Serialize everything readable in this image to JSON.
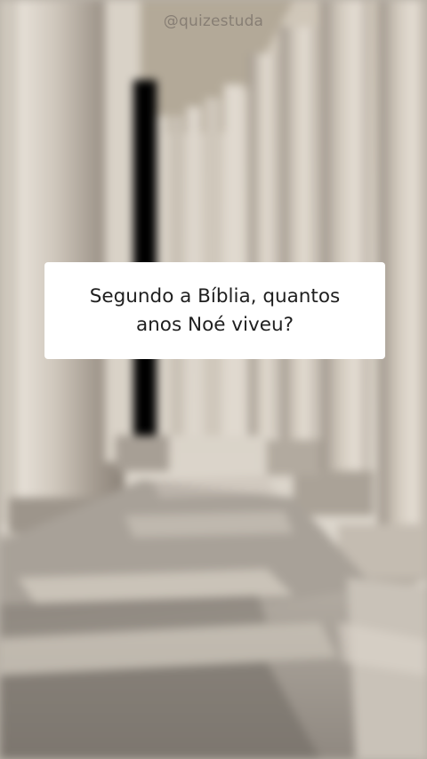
{
  "watermark": {
    "text": "@quizestuda"
  },
  "question": {
    "text": "Segundo a Bíblia, quantos anos Noé viveu?"
  },
  "scene": {
    "description_colors": {
      "sky": "#d8d3cb",
      "stone_light": "#ddd6cc",
      "stone_mid": "#b9b1a6",
      "stone_dark": "#8c847a",
      "shadow": "#6f6962",
      "pavement": "#a39d95"
    }
  }
}
